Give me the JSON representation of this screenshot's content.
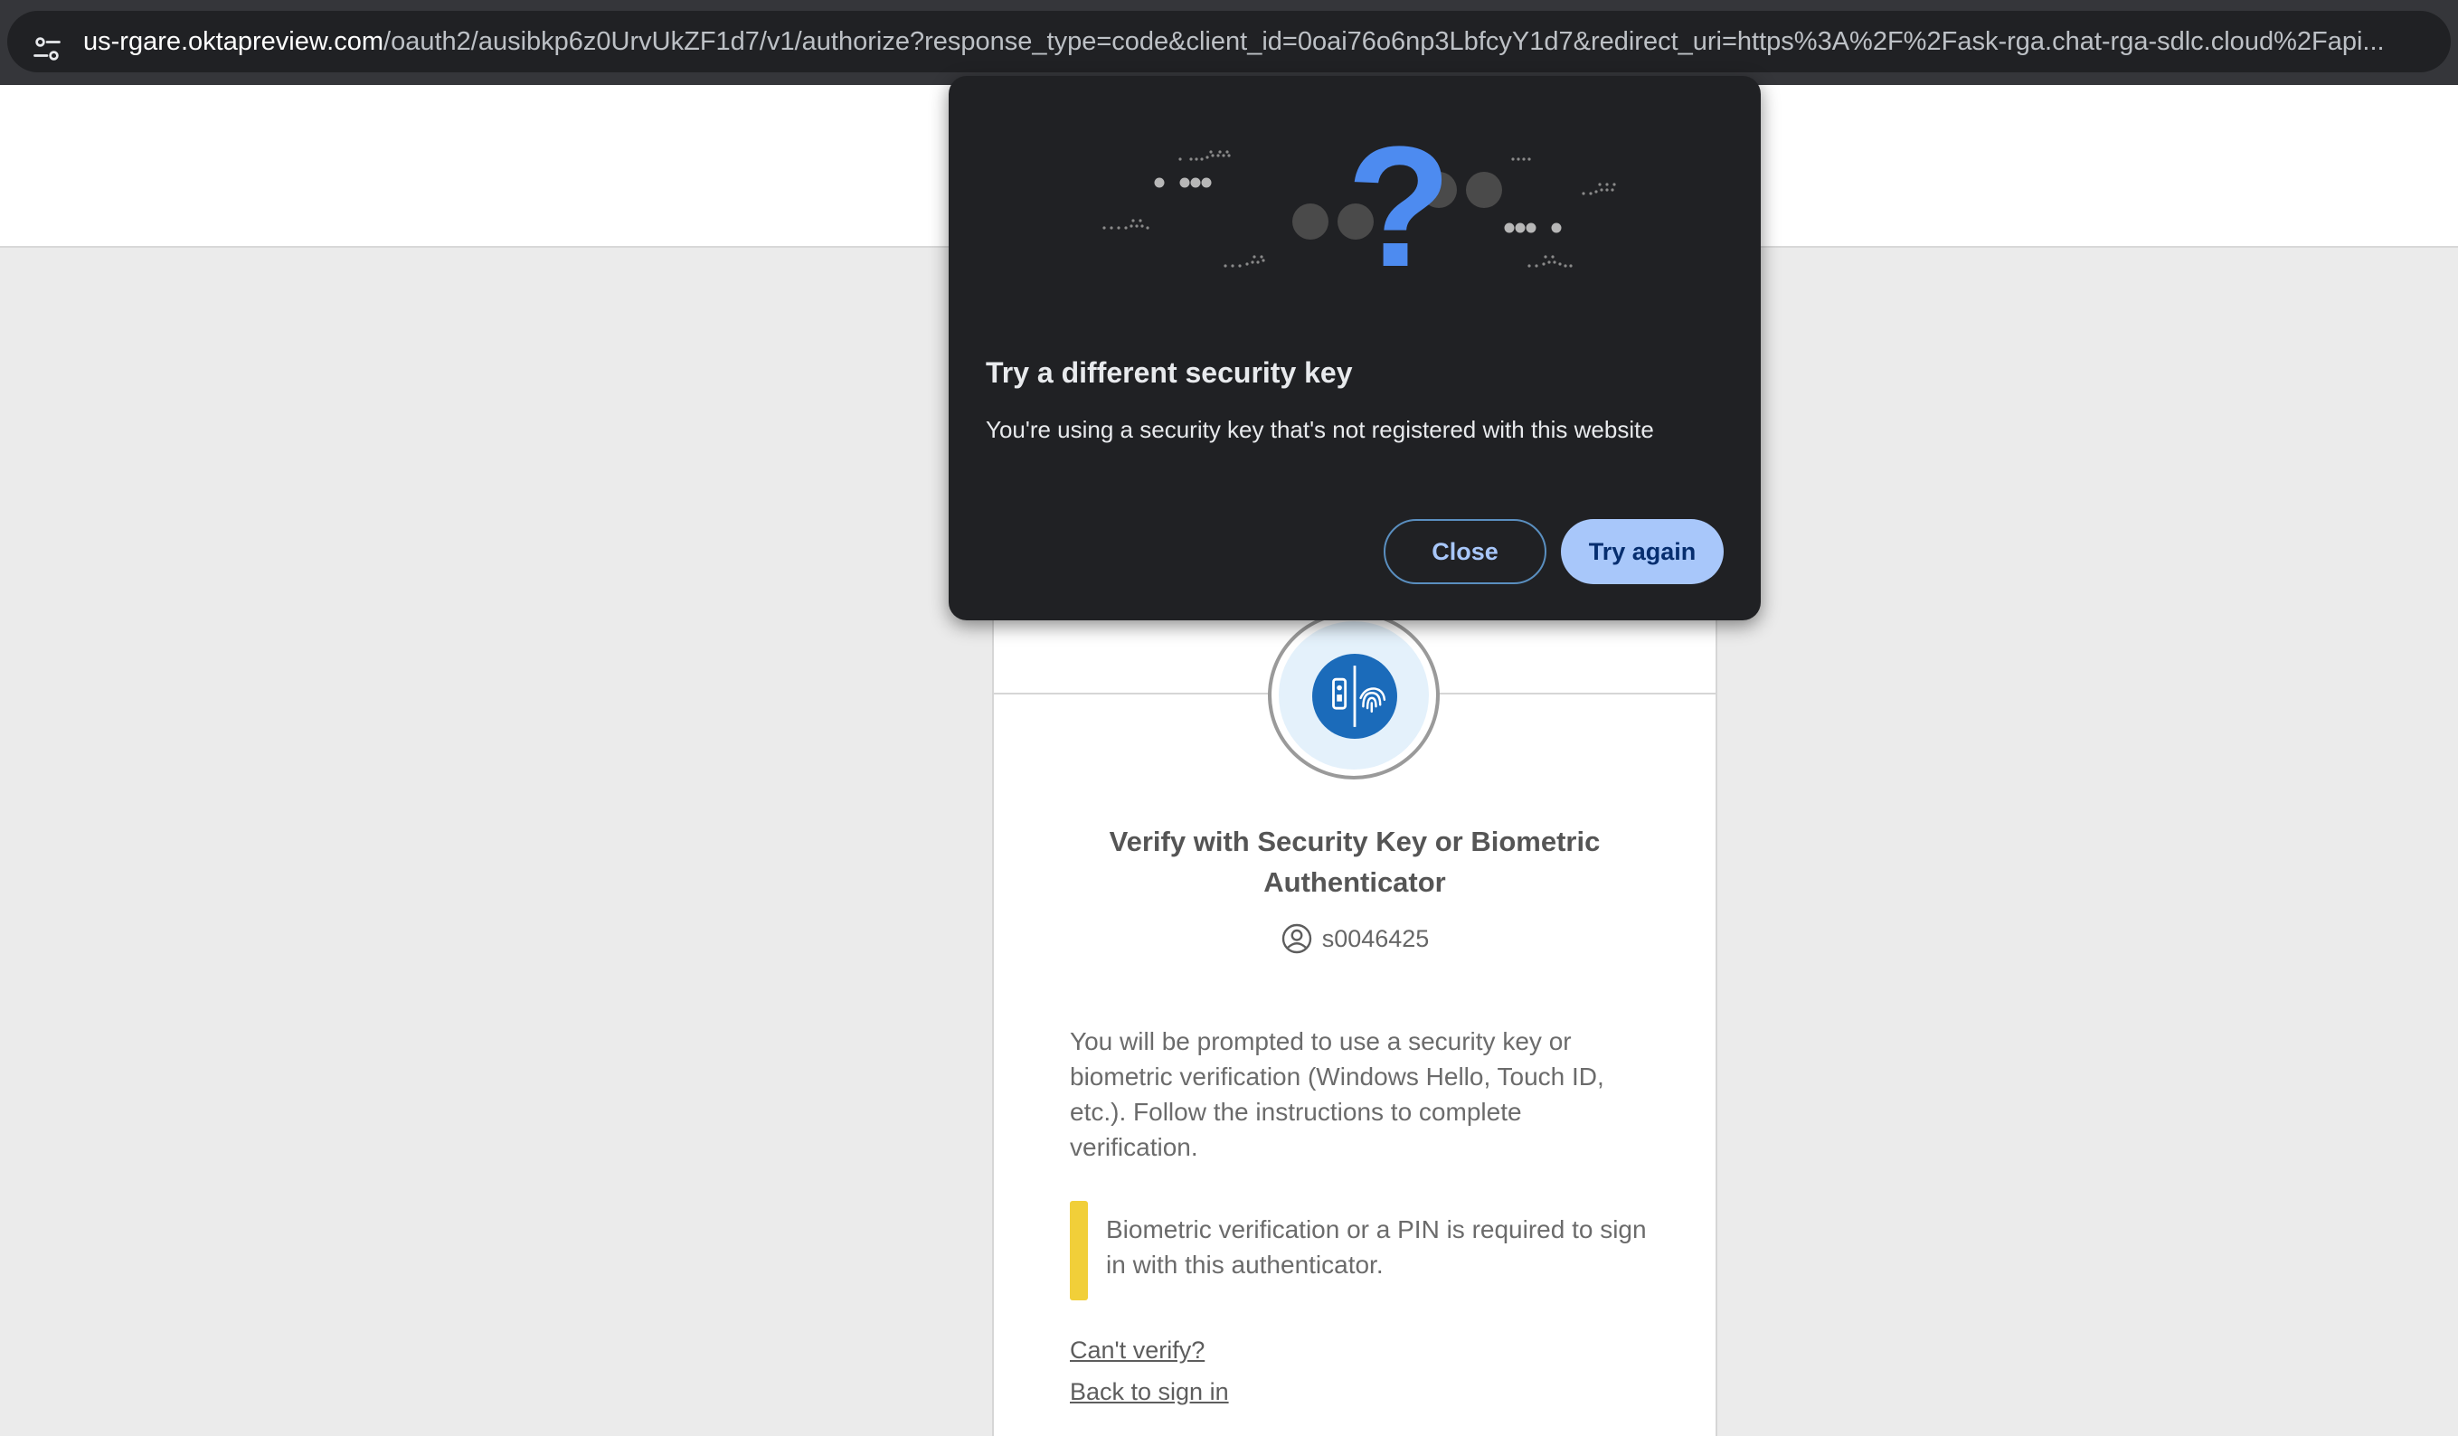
{
  "browser": {
    "url_host": "us-rgare.oktapreview.com",
    "url_path": "/oauth2/ausibkp6z0UrvUkZF1d7/v1/authorize?response_type=code&client_id=0oai76o6np3LbfcyY1d7&redirect_uri=https%3A%2F%2Fask-rga.chat-rga-sdlc.cloud%2Fapi..."
  },
  "dialog": {
    "title": "Try a different security key",
    "message": "You're using a security key that's not registered with this website",
    "close_label": "Close",
    "retry_label": "Try again",
    "accent_color": "#a8c7fa",
    "question_color": "#4d8bf0"
  },
  "card": {
    "title": "Verify with Security Key or Biometric Authenticator",
    "username": "s0046425",
    "description": "You will be prompted to use a security key or biometric verification (Windows Hello, Touch ID, etc.). Follow the instructions to complete verification.",
    "callout": "Biometric verification or a PIN is required to sign in with this authenticator.",
    "cant_verify": "Can't verify?",
    "back_to_sign_in": "Back to sign in",
    "icon": "security-key-fingerprint-icon",
    "brand_color": "#1b6bba",
    "callout_color": "#f1cf39"
  }
}
